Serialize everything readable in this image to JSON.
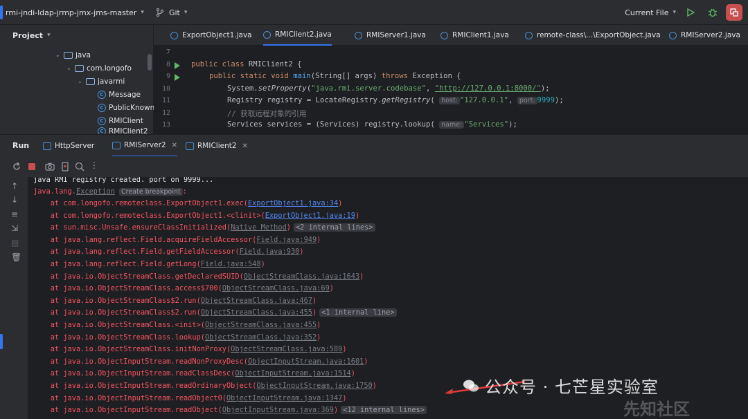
{
  "topbar": {
    "project_name": "rmi-jndi-ldap-jrmp-jmx-jms-master",
    "vcs_label": "Git",
    "run_config": "Current File"
  },
  "project_panel": {
    "title": "Project",
    "tree": [
      {
        "label": "java",
        "type": "folder"
      },
      {
        "label": "com.longofo",
        "type": "folder"
      },
      {
        "label": "javarmi",
        "type": "folder"
      },
      {
        "label": "Message",
        "type": "class"
      },
      {
        "label": "PublicKnown",
        "type": "class"
      },
      {
        "label": "RMIClient",
        "type": "class"
      },
      {
        "label": "RMIClient2",
        "type": "class"
      }
    ]
  },
  "editor": {
    "tabs": [
      {
        "label": "ExportObject1.java",
        "active": false
      },
      {
        "label": "RMIClient2.java",
        "active": true
      },
      {
        "label": "RMIServer1.java",
        "active": false
      },
      {
        "label": "RMIClient1.java",
        "active": false
      },
      {
        "label": "remote-class\\...\\ExportObject.java",
        "active": false
      },
      {
        "label": "RMIServer2.java",
        "active": false
      }
    ],
    "line_numbers": [
      "7",
      "8",
      "9",
      "10",
      "11",
      "12",
      "13"
    ],
    "code": {
      "l8_kw": "public class",
      "l8_rest": " RMIClient2 {",
      "l9_kw": "public static void",
      "l9_fn": "main",
      "l9_args": "(String[] args) ",
      "l9_throws": "throws",
      "l9_end": " Exception {",
      "l10_pre": "System.",
      "l10_method": "setProperty",
      "l10_str": "\"java.rmi.server.codebase\"",
      "l10_url": "\"http://127.0.0.1:8000/\"",
      "l11_pre": "Registry registry = LocateRegistry.",
      "l11_method": "getRegistry",
      "l11_hint_host": "host:",
      "l11_str": "\"127.0.0.1\"",
      "l11_hint_port": "port:",
      "l11_num": "9999",
      "l12_comment": "// 获取远程对象的引用",
      "l13_pre": "Services services = (Services) registry.lookup(",
      "l13_hint": "name:",
      "l13_str": "\"Services\""
    }
  },
  "run": {
    "title": "Run",
    "tabs": [
      {
        "label": "HttpServer",
        "active": false
      },
      {
        "label": "RMIServer2",
        "active": true
      },
      {
        "label": "RMIClient2",
        "active": false
      }
    ],
    "console": {
      "line0": "java RMI registry created. port on 9999...",
      "exception_prefix": "java.lang.",
      "exception_name": "Exception",
      "create_breakpoint": "Create breakpoint",
      "exception_suffix": ":",
      "frames": [
        {
          "text": "    at com.longofo.remoteclass.ExportObject1.exec(",
          "link": "ExportObject1.java:34",
          "style": "link",
          "pill": "",
          "chev": false
        },
        {
          "text": "    at com.longofo.remoteclass.ExportObject1.<clinit>(",
          "link": "ExportObject1.java:19",
          "style": "link",
          "pill": "",
          "chev": false
        },
        {
          "text": "    at sun.misc.Unsafe.ensureClassInitialized(",
          "link": "Native Method",
          "style": "gray",
          "pill": "<2 internal lines>",
          "chev": true
        },
        {
          "text": "    at java.lang.reflect.Field.acquireFieldAccessor(",
          "link": "Field.java:949",
          "style": "gray",
          "pill": "",
          "chev": false
        },
        {
          "text": "    at java.lang.reflect.Field.getFieldAccessor(",
          "link": "Field.java:930",
          "style": "gray",
          "pill": "",
          "chev": false
        },
        {
          "text": "    at java.lang.reflect.Field.getLong(",
          "link": "Field.java:548",
          "style": "gray",
          "pill": "",
          "chev": false
        },
        {
          "text": "    at java.io.ObjectStreamClass.getDeclaredSUID(",
          "link": "ObjectStreamClass.java:1643",
          "style": "gray",
          "pill": "",
          "chev": false
        },
        {
          "text": "    at java.io.ObjectStreamClass.access$700(",
          "link": "ObjectStreamClass.java:69",
          "style": "gray",
          "pill": "",
          "chev": false
        },
        {
          "text": "    at java.io.ObjectStreamClass$2.run(",
          "link": "ObjectStreamClass.java:467",
          "style": "gray",
          "pill": "",
          "chev": false
        },
        {
          "text": "    at java.io.ObjectStreamClass$2.run(",
          "link": "ObjectStreamClass.java:455",
          "style": "gray",
          "pill": "<1 internal line>",
          "chev": true
        },
        {
          "text": "    at java.io.ObjectStreamClass.<init>(",
          "link": "ObjectStreamClass.java:455",
          "style": "gray",
          "pill": "",
          "chev": false
        },
        {
          "text": "    at java.io.ObjectStreamClass.lookup(",
          "link": "ObjectStreamClass.java:352",
          "style": "gray",
          "pill": "",
          "chev": false
        },
        {
          "text": "    at java.io.ObjectStreamClass.initNonProxy(",
          "link": "ObjectStreamClass.java:589",
          "style": "gray",
          "pill": "",
          "chev": false
        },
        {
          "text": "    at java.io.ObjectInputStream.readNonProxyDesc(",
          "link": "ObjectInputStream.java:1601",
          "style": "gray",
          "pill": "",
          "chev": false
        },
        {
          "text": "    at java.io.ObjectInputStream.readClassDesc(",
          "link": "ObjectInputStream.java:1514",
          "style": "gray",
          "pill": "",
          "chev": false
        },
        {
          "text": "    at java.io.ObjectInputStream.readOrdinaryObject(",
          "link": "ObjectInputStream.java:1750",
          "style": "gray",
          "pill": "",
          "chev": false
        },
        {
          "text": "    at java.io.ObjectInputStream.readObject0(",
          "link": "ObjectInputStream.java:1347",
          "style": "gray",
          "pill": "",
          "chev": false
        },
        {
          "text": "    at java.io.ObjectInputStream.readObject(",
          "link": "ObjectInputStream.java:369",
          "style": "gray",
          "pill": "<12 internal lines>",
          "chev": true
        }
      ]
    }
  },
  "watermark": {
    "text": "公众号 · 七芒星实验室",
    "text2": "先知社区"
  },
  "colors": {
    "accent": "#3574f0",
    "error": "#f75464",
    "link": "#548af7",
    "run_green": "#5fb865",
    "badge_red": "#c94f4f"
  }
}
